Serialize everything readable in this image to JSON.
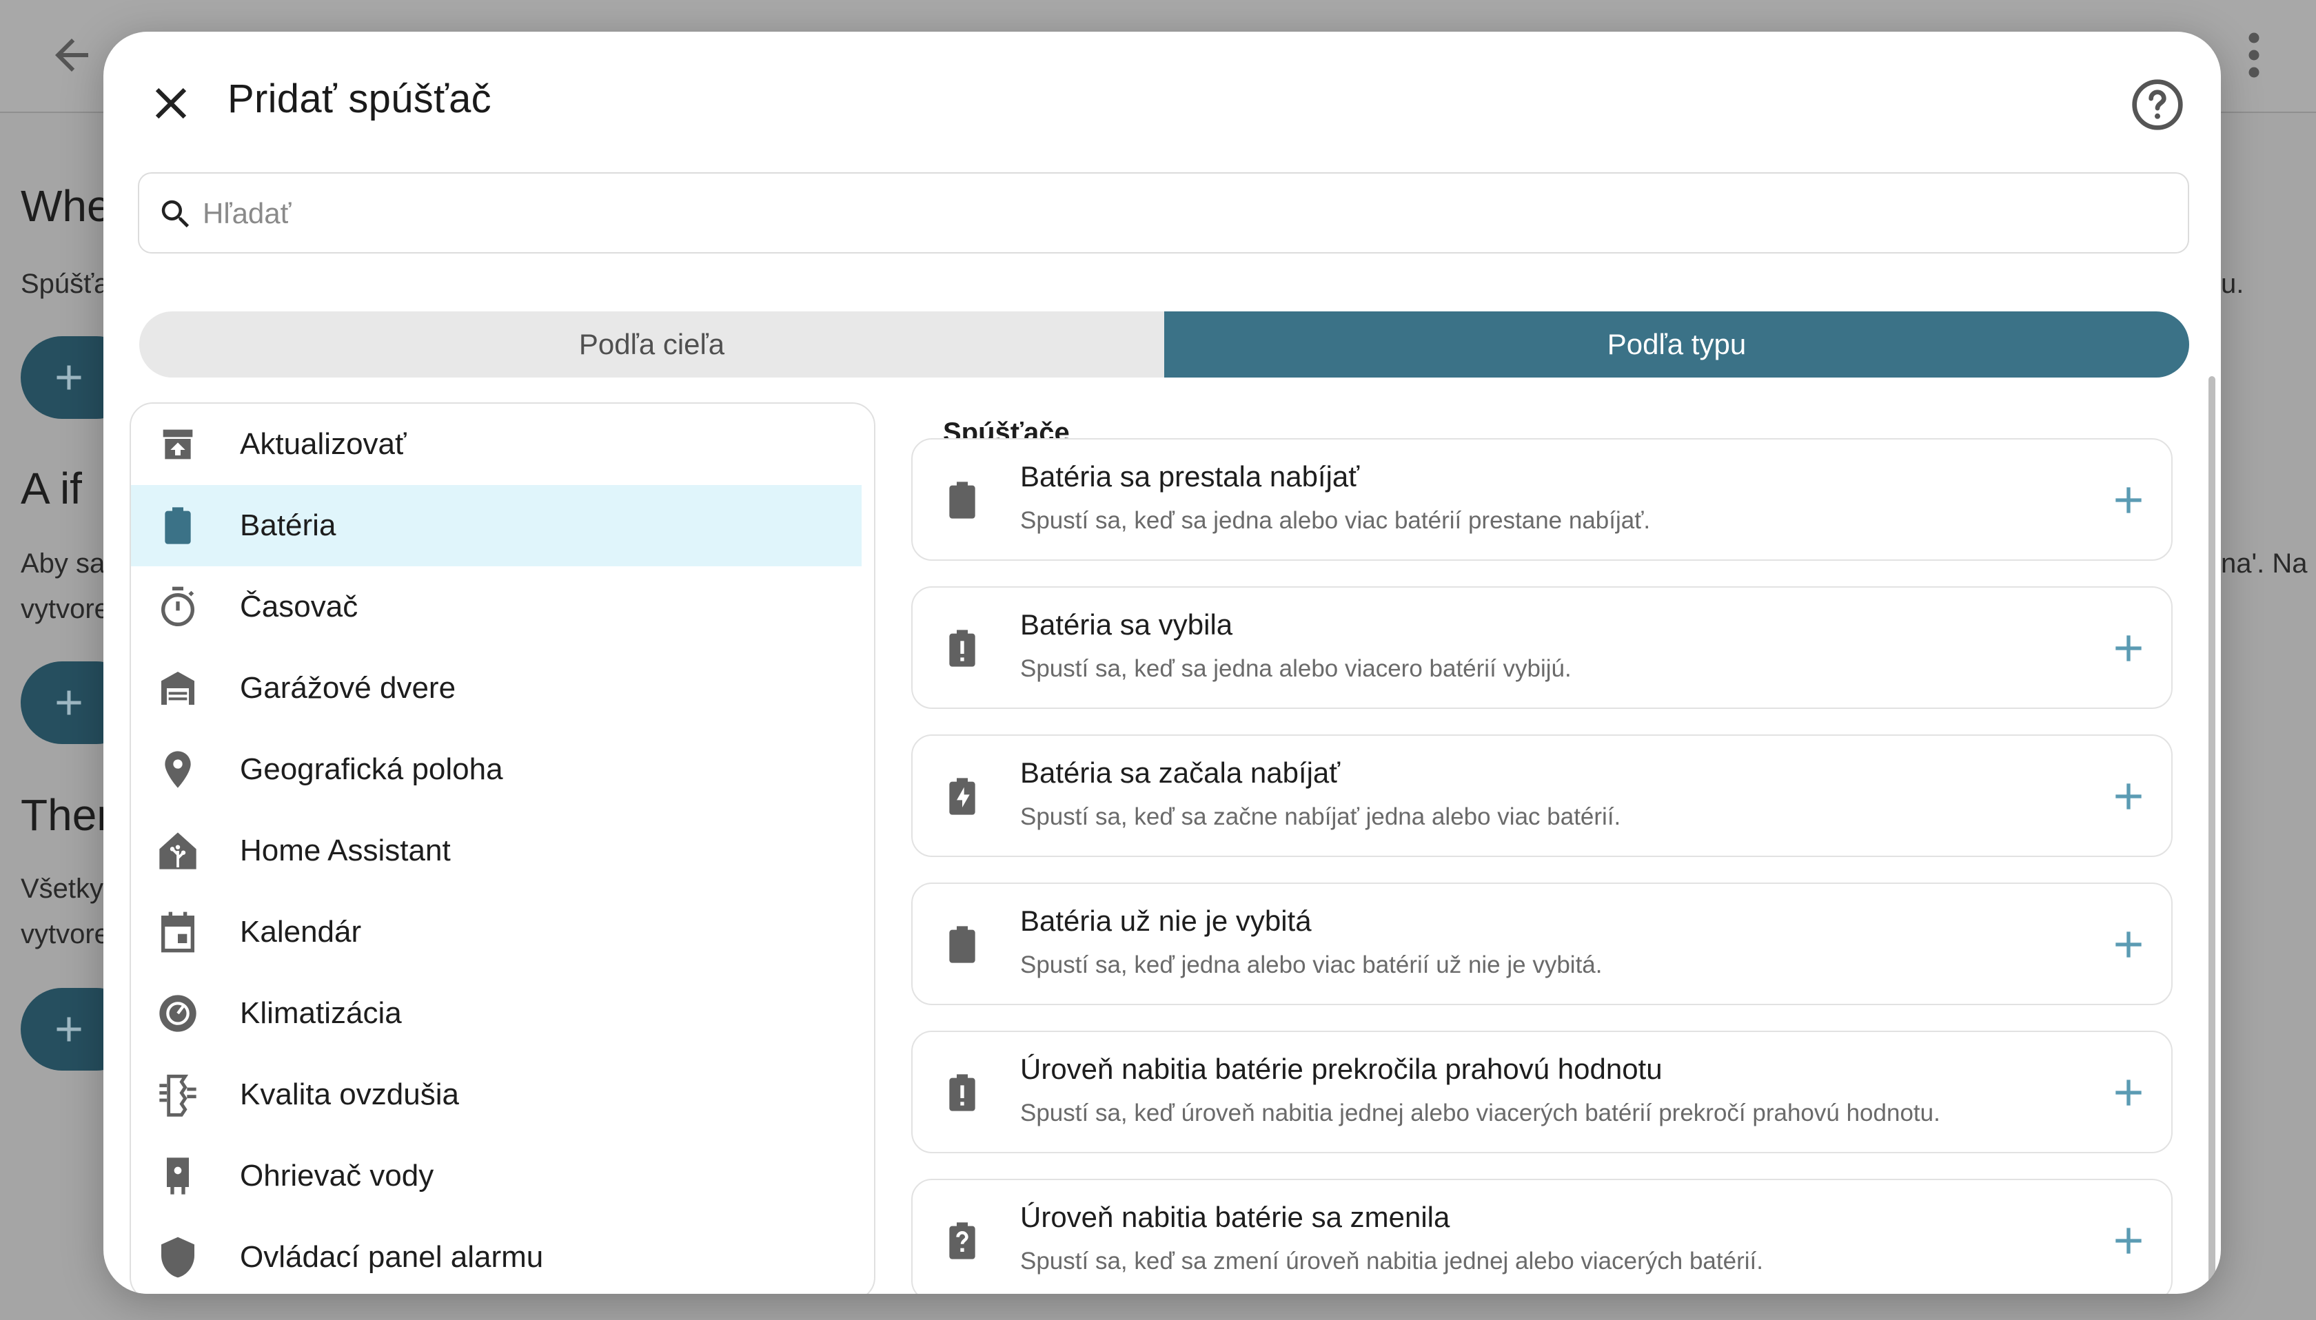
{
  "background": {
    "heading_when": "Whe",
    "text_when": "Spúšťa",
    "heading_aif": "A if",
    "text_aif_1": "Aby sa",
    "text_aif_2": "vytvore",
    "heading_then": "Then",
    "text_then_1": "Všetky",
    "text_then_2": "vytvore",
    "right_fragment_1": "u.",
    "right_fragment_2": "na'. Na"
  },
  "dialog": {
    "title": "Pridať spúšťač",
    "search_placeholder": "Hľadať",
    "tabs": [
      {
        "label": "Podľa cieľa",
        "active": false
      },
      {
        "label": "Podľa typu",
        "active": true
      }
    ],
    "categories": [
      {
        "label": "Aktualizovať",
        "icon": "update-package-icon"
      },
      {
        "label": "Batéria",
        "icon": "battery-icon",
        "selected": true
      },
      {
        "label": "Časovač",
        "icon": "timer-icon"
      },
      {
        "label": "Garážové dvere",
        "icon": "garage-icon"
      },
      {
        "label": "Geografická poloha",
        "icon": "map-marker-icon"
      },
      {
        "label": "Home Assistant",
        "icon": "home-assistant-icon"
      },
      {
        "label": "Kalendár",
        "icon": "calendar-icon"
      },
      {
        "label": "Klimatizácia",
        "icon": "thermostat-icon"
      },
      {
        "label": "Kvalita ovzdušia",
        "icon": "air-filter-icon"
      },
      {
        "label": "Ohrievač vody",
        "icon": "water-boiler-icon"
      },
      {
        "label": "Ovládací panel alarmu",
        "icon": "shield-icon"
      }
    ],
    "section_title": "Spúšťače",
    "triggers": [
      {
        "title": "Batéria sa prestala nabíjať",
        "description": "Spustí sa, keď sa jedna alebo viac batérií prestane nabíjať.",
        "icon": "battery-icon"
      },
      {
        "title": "Batéria sa vybila",
        "description": "Spustí sa, keď sa jedna alebo viacero batérií vybijú.",
        "icon": "battery-alert-icon"
      },
      {
        "title": "Batéria sa začala nabíjať",
        "description": "Spustí sa, keď sa začne nabíjať jedna alebo viac batérií.",
        "icon": "battery-charging-icon"
      },
      {
        "title": "Batéria už nie je vybitá",
        "description": "Spustí sa, keď jedna alebo viac batérií už nie je vybitá.",
        "icon": "battery-icon"
      },
      {
        "title": "Úroveň nabitia batérie prekročila prahovú hodnotu",
        "description": "Spustí sa, keď úroveň nabitia jednej alebo viacerých batérií prekročí prahovú hodnotu.",
        "icon": "battery-alert-icon"
      },
      {
        "title": "Úroveň nabitia batérie sa zmenila",
        "description": "Spustí sa, keď sa zmení úroveň nabitia jednej alebo viacerých batérií.",
        "icon": "battery-unknown-icon"
      }
    ]
  },
  "colors": {
    "accent": "#3b7287",
    "selected_bg": "#e0f5fb",
    "add_icon": "#5b9bb3",
    "icon_gray": "#616161"
  }
}
